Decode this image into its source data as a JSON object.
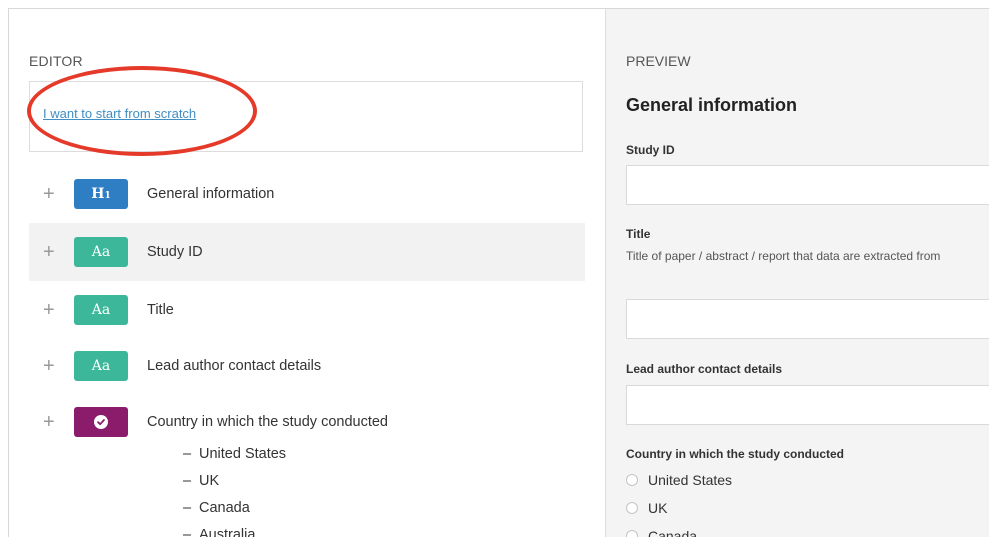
{
  "editor": {
    "title": "EDITOR",
    "start_link": "I want to start from scratch",
    "rows": [
      {
        "label": "General information",
        "badge": "heading",
        "badge_icon": "heading-h1-icon",
        "selected": false
      },
      {
        "label": "Study ID",
        "badge": "text",
        "badge_icon": "text-aa-icon",
        "selected": true
      },
      {
        "label": "Title",
        "badge": "text",
        "badge_icon": "text-aa-icon",
        "selected": false
      },
      {
        "label": "Lead author contact details",
        "badge": "text",
        "badge_icon": "text-aa-icon",
        "selected": false
      },
      {
        "label": "Country in which the study conducted",
        "badge": "choice",
        "badge_icon": "check-circle-icon",
        "selected": false
      }
    ],
    "badge_text": {
      "heading_main": "H",
      "heading_sub": "1",
      "text": "Aa"
    },
    "options": [
      "United States",
      "UK",
      "Canada",
      "Australia"
    ],
    "option_prefix": "–"
  },
  "preview": {
    "title": "PREVIEW",
    "heading": "General information",
    "fields": [
      {
        "label": "Study ID",
        "value": ""
      },
      {
        "label": "Title",
        "description": "Title of paper / abstract / report that data are extracted from",
        "value": ""
      },
      {
        "label": "Lead author contact details",
        "value": ""
      }
    ],
    "radio_group": {
      "label": "Country in which the study conducted",
      "options": [
        "United States",
        "UK",
        "Canada"
      ]
    }
  },
  "colors": {
    "heading_badge": "#2f7ec4",
    "text_badge": "#3db79a",
    "choice_badge": "#8a1c6b",
    "link": "#3f8ec4",
    "annotation_circle": "#e53a2a"
  }
}
